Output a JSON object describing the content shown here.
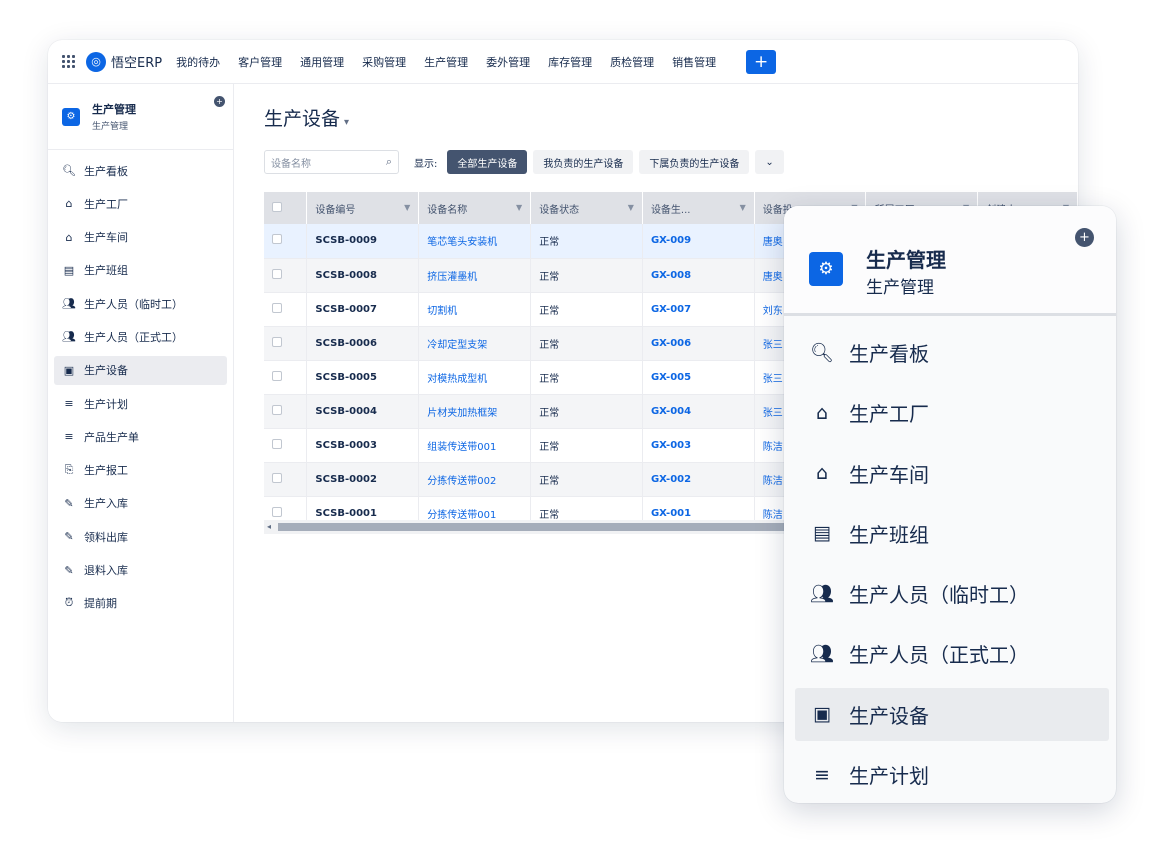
{
  "topbar": {
    "brand": "悟空ERP",
    "nav": [
      "我的待办",
      "客户管理",
      "通用管理",
      "采购管理",
      "生产管理",
      "委外管理",
      "库存管理",
      "质检管理",
      "销售管理"
    ],
    "plus": "+"
  },
  "sidebar": {
    "title": "生产管理",
    "subtitle": "生产管理",
    "items": [
      {
        "label": "生产看板",
        "icon": "search-icon",
        "glyph": "🔍︎"
      },
      {
        "label": "生产工厂",
        "icon": "factory-icon",
        "glyph": "⌂"
      },
      {
        "label": "生产车间",
        "icon": "home-icon",
        "glyph": "⌂"
      },
      {
        "label": "生产班组",
        "icon": "team-cart-icon",
        "glyph": "▤"
      },
      {
        "label": "生产人员（临时工）",
        "icon": "users-icon",
        "glyph": "👥︎"
      },
      {
        "label": "生产人员（正式工）",
        "icon": "users-icon",
        "glyph": "👥︎"
      },
      {
        "label": "生产设备",
        "icon": "machine-icon",
        "glyph": "▣",
        "active": true
      },
      {
        "label": "生产计划",
        "icon": "list-icon",
        "glyph": "≡"
      },
      {
        "label": "产品生产单",
        "icon": "list-icon",
        "glyph": "≡"
      },
      {
        "label": "生产报工",
        "icon": "report-icon",
        "glyph": "⎘"
      },
      {
        "label": "生产入库",
        "icon": "edit-doc-icon",
        "glyph": "✎"
      },
      {
        "label": "领料出库",
        "icon": "edit-doc-icon",
        "glyph": "✎"
      },
      {
        "label": "退料入库",
        "icon": "edit-doc-icon",
        "glyph": "✎"
      },
      {
        "label": "提前期",
        "icon": "alarm-clock-icon",
        "glyph": "⏰︎"
      }
    ]
  },
  "main": {
    "title": "生产设备",
    "search_placeholder": "设备名称",
    "show_label": "显示:",
    "filters": [
      "全部生产设备",
      "我负责的生产设备",
      "下属负责的生产设备"
    ],
    "columns": [
      "设备编号",
      "设备名称",
      "设备状态",
      "设备生...",
      "设备投...",
      "所属工厂",
      "创建人"
    ],
    "rows": [
      {
        "code": "SCSB-0009",
        "name": "笔芯笔头安装机",
        "status": "正常",
        "gx": "GX-009",
        "person": "唐奥"
      },
      {
        "code": "SCSB-0008",
        "name": "挤压灌墨机",
        "status": "正常",
        "gx": "GX-008",
        "person": "唐奥"
      },
      {
        "code": "SCSB-0007",
        "name": "切割机",
        "status": "正常",
        "gx": "GX-007",
        "person": "刘东"
      },
      {
        "code": "SCSB-0006",
        "name": "冷却定型支架",
        "status": "正常",
        "gx": "GX-006",
        "person": "张三"
      },
      {
        "code": "SCSB-0005",
        "name": "对模热成型机",
        "status": "正常",
        "gx": "GX-005",
        "person": "张三"
      },
      {
        "code": "SCSB-0004",
        "name": "片材夹加热框架",
        "status": "正常",
        "gx": "GX-004",
        "person": "张三"
      },
      {
        "code": "SCSB-0003",
        "name": "组装传送带001",
        "status": "正常",
        "gx": "GX-003",
        "person": "陈洁"
      },
      {
        "code": "SCSB-0002",
        "name": "分拣传送带002",
        "status": "正常",
        "gx": "GX-002",
        "person": "陈洁"
      },
      {
        "code": "SCSB-0001",
        "name": "分拣传送带001",
        "status": "正常",
        "gx": "GX-001",
        "person": "陈洁"
      }
    ]
  },
  "zoom_panel": {
    "title": "生产管理",
    "subtitle": "生产管理",
    "items": [
      {
        "label": "生产看板",
        "icon": "search-icon",
        "glyph": "🔍︎"
      },
      {
        "label": "生产工厂",
        "icon": "factory-icon",
        "glyph": "⌂"
      },
      {
        "label": "生产车间",
        "icon": "home-icon",
        "glyph": "⌂"
      },
      {
        "label": "生产班组",
        "icon": "team-cart-icon",
        "glyph": "▤"
      },
      {
        "label": "生产人员（临时工）",
        "icon": "users-icon",
        "glyph": "👥︎"
      },
      {
        "label": "生产人员（正式工）",
        "icon": "users-icon",
        "glyph": "👥︎"
      },
      {
        "label": "生产设备",
        "icon": "machine-icon",
        "glyph": "▣",
        "active": true
      },
      {
        "label": "生产计划",
        "icon": "list-icon",
        "glyph": "≡"
      }
    ]
  },
  "colors": {
    "accent": "#0c66e4",
    "active_bg": "#ebecf0",
    "selected_row": "#e9f2ff"
  }
}
